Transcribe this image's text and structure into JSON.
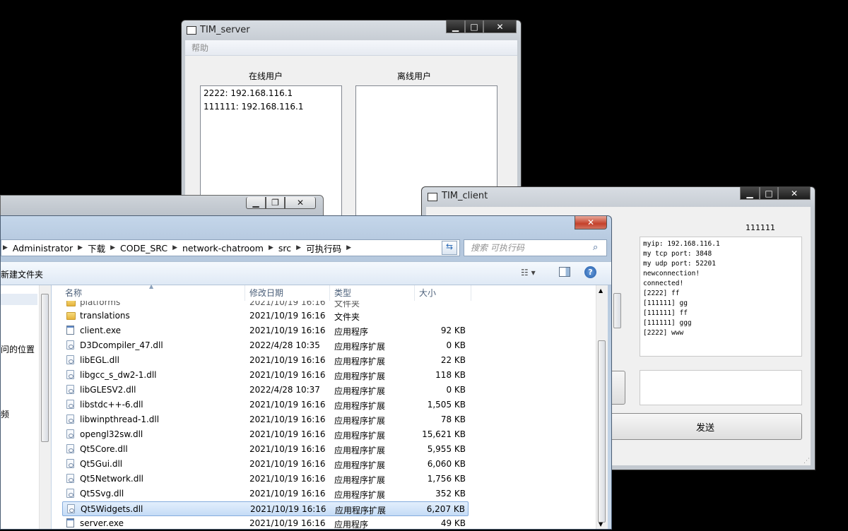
{
  "server": {
    "title": "TIM_server",
    "menu_help": "帮助",
    "online_label": "在线用户",
    "offline_label": "离线用户",
    "online_users": [
      "2222: 192.168.116.1",
      "111111: 192.168.116.1"
    ],
    "offline_users": []
  },
  "client": {
    "title": "TIM_client",
    "username": "111111",
    "log": [
      "myip: 192.168.116.1",
      "my tcp port: 3848",
      "my udp port: 52201",
      "newconnection!",
      "connected!",
      "[2222] ff",
      "[111111] gg",
      "[111111] ff",
      "[111111] ggg",
      "[2222] www"
    ],
    "message_input": "",
    "send_label": "发送"
  },
  "explorer": {
    "breadcrumb": [
      "Administrator",
      "下载",
      "CODE_SRC",
      "network-chatroom",
      "src",
      "可执行码"
    ],
    "search_placeholder": "搜索 可执行码",
    "new_folder_label": "新建文件夹",
    "nav_items": [
      "问的位置",
      "频"
    ],
    "columns": {
      "name": "名称",
      "date": "修改日期",
      "type": "类型",
      "size": "大小"
    },
    "partial_row": {
      "name": "platforms",
      "date": "2021/10/19 16:16",
      "type": "文件夹"
    },
    "files": [
      {
        "name": "translations",
        "date": "2021/10/19 16:16",
        "type": "文件夹",
        "size": "",
        "icon": "folder-icon"
      },
      {
        "name": "client.exe",
        "date": "2021/10/19 16:16",
        "type": "应用程序",
        "size": "92 KB",
        "icon": "exe-icon"
      },
      {
        "name": "D3Dcompiler_47.dll",
        "date": "2022/4/28 10:35",
        "type": "应用程序扩展",
        "size": "0 KB",
        "icon": "dll-icon"
      },
      {
        "name": "libEGL.dll",
        "date": "2021/10/19 16:16",
        "type": "应用程序扩展",
        "size": "22 KB",
        "icon": "dll-icon"
      },
      {
        "name": "libgcc_s_dw2-1.dll",
        "date": "2021/10/19 16:16",
        "type": "应用程序扩展",
        "size": "118 KB",
        "icon": "dll-icon"
      },
      {
        "name": "libGLESV2.dll",
        "date": "2022/4/28 10:37",
        "type": "应用程序扩展",
        "size": "0 KB",
        "icon": "dll-icon"
      },
      {
        "name": "libstdc++-6.dll",
        "date": "2021/10/19 16:16",
        "type": "应用程序扩展",
        "size": "1,505 KB",
        "icon": "dll-icon"
      },
      {
        "name": "libwinpthread-1.dll",
        "date": "2021/10/19 16:16",
        "type": "应用程序扩展",
        "size": "78 KB",
        "icon": "dll-icon"
      },
      {
        "name": "opengl32sw.dll",
        "date": "2021/10/19 16:16",
        "type": "应用程序扩展",
        "size": "15,621 KB",
        "icon": "dll-icon"
      },
      {
        "name": "Qt5Core.dll",
        "date": "2021/10/19 16:16",
        "type": "应用程序扩展",
        "size": "5,955 KB",
        "icon": "dll-icon"
      },
      {
        "name": "Qt5Gui.dll",
        "date": "2021/10/19 16:16",
        "type": "应用程序扩展",
        "size": "6,060 KB",
        "icon": "dll-icon"
      },
      {
        "name": "Qt5Network.dll",
        "date": "2021/10/19 16:16",
        "type": "应用程序扩展",
        "size": "1,756 KB",
        "icon": "dll-icon"
      },
      {
        "name": "Qt5Svg.dll",
        "date": "2021/10/19 16:16",
        "type": "应用程序扩展",
        "size": "352 KB",
        "icon": "dll-icon"
      },
      {
        "name": "Qt5Widgets.dll",
        "date": "2021/10/19 16:16",
        "type": "应用程序扩展",
        "size": "6,207 KB",
        "icon": "dll-icon",
        "selected": true
      },
      {
        "name": "server.exe",
        "date": "2021/10/19 16:16",
        "type": "应用程序",
        "size": "49 KB",
        "icon": "exe-icon"
      }
    ]
  }
}
